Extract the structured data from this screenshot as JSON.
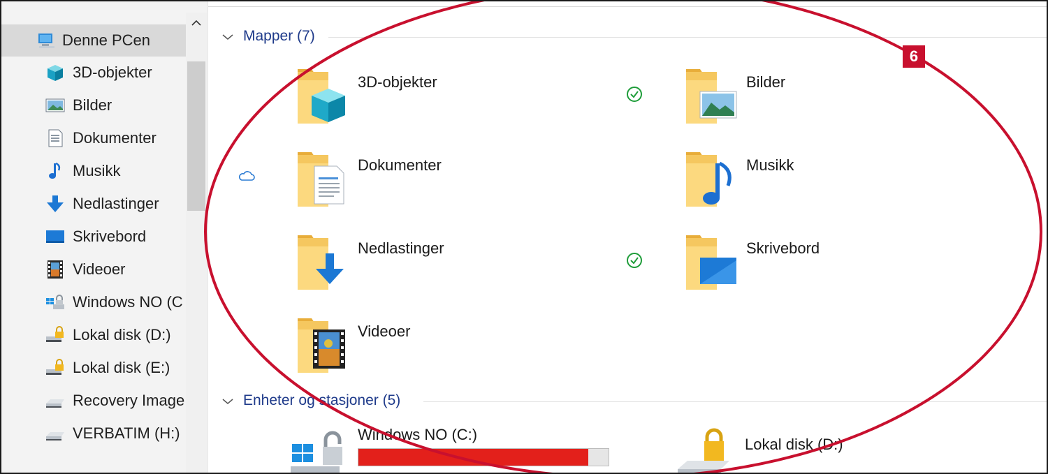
{
  "sidebar": {
    "items": [
      {
        "label": "Denne PCen",
        "icon": "this-pc-icon"
      },
      {
        "label": "3D-objekter",
        "icon": "3d-objects-icon"
      },
      {
        "label": "Bilder",
        "icon": "pictures-icon"
      },
      {
        "label": "Dokumenter",
        "icon": "documents-icon"
      },
      {
        "label": "Musikk",
        "icon": "music-icon"
      },
      {
        "label": "Nedlastinger",
        "icon": "downloads-icon"
      },
      {
        "label": "Skrivebord",
        "icon": "desktop-icon"
      },
      {
        "label": "Videoer",
        "icon": "videos-icon"
      },
      {
        "label": "Windows NO (C",
        "icon": "windows-drive-icon"
      },
      {
        "label": "Lokal disk (D:)",
        "icon": "locked-drive-icon"
      },
      {
        "label": "Lokal disk (E:)",
        "icon": "locked-drive-icon"
      },
      {
        "label": "Recovery Image",
        "icon": "drive-icon"
      },
      {
        "label": "VERBATIM (H:)",
        "icon": "usb-drive-icon"
      }
    ]
  },
  "main": {
    "folders_group": {
      "header": "Mapper (7)"
    },
    "folders": [
      {
        "name": "3D-objekter",
        "icon": "3d-objects-folder-icon",
        "status": "synced-check"
      },
      {
        "name": "Bilder",
        "icon": "pictures-folder-icon",
        "status": ""
      },
      {
        "name": "Dokumenter",
        "icon": "documents-folder-icon",
        "status": "cloud"
      },
      {
        "name": "Musikk",
        "icon": "music-folder-icon",
        "status": ""
      },
      {
        "name": "Nedlastinger",
        "icon": "downloads-folder-icon",
        "status": "synced-check"
      },
      {
        "name": "Skrivebord",
        "icon": "desktop-folder-icon",
        "status": ""
      },
      {
        "name": "Videoer",
        "icon": "videos-folder-icon",
        "status": ""
      }
    ],
    "drives_group": {
      "header": "Enheter og stasjoner (5)"
    },
    "drives": [
      {
        "name": "Windows NO (C:)",
        "used_fraction": 0.92
      },
      {
        "name": "Lokal disk (D:)"
      }
    ]
  },
  "annotation": {
    "badge": "6",
    "color": "#c8102e"
  },
  "colors": {
    "accent": "#1e3a8a",
    "folder": "#f4c35a",
    "drive_full": "#e3201b",
    "sync_green": "#1f9d3a",
    "cloud_blue": "#2b7bd3"
  }
}
